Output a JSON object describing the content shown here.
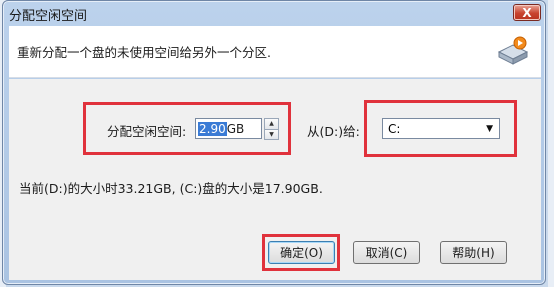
{
  "window": {
    "title": "分配空闲空间",
    "close_symbol": "X"
  },
  "header": {
    "description": "重新分配一个盘的未使用空间给另外一个分区.",
    "icon": "disk-partition-icon"
  },
  "form": {
    "size_label": "分配空闲空间:",
    "size_value": "2.90",
    "size_unit": "GB",
    "from_label": "从(D:)给:",
    "target_drive": "C:"
  },
  "info": "当前(D:)的大小时33.21GB, (C:)盘的大小是17.90GB.",
  "buttons": {
    "ok": "确定(O)",
    "cancel": "取消(C)",
    "help": "帮助(H)"
  },
  "colors": {
    "highlight": "#e0323c",
    "selection": "#3a7bd5",
    "close": "#c8432f"
  }
}
